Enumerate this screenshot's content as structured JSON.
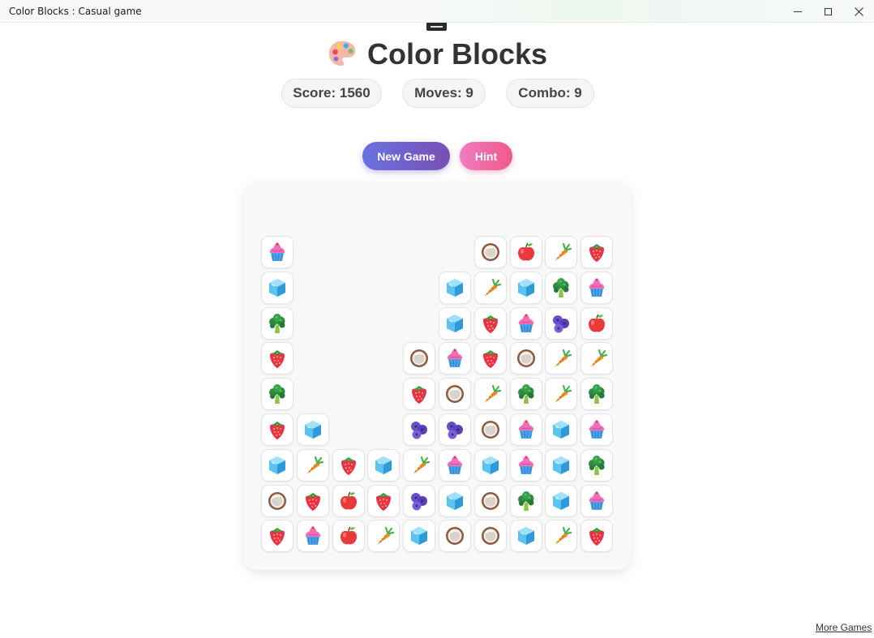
{
  "window": {
    "title": "Color Blocks : Casual game"
  },
  "header": {
    "title": "Color Blocks",
    "icon": "palette-icon"
  },
  "stats": {
    "score": "Score: 1560",
    "moves": "Moves: 9",
    "combo": "Combo: 9"
  },
  "buttons": {
    "new_game": "New Game",
    "hint": "Hint"
  },
  "footer": {
    "more_games": "More Games"
  },
  "colors": {
    "new_game_start": "#6872e0",
    "new_game_end": "#7a4fb4",
    "hint_start": "#f07bc0",
    "hint_end": "#ef5a8a"
  },
  "board": {
    "columns": 10,
    "rows": 9,
    "cells": [
      [
        "cupcake",
        null,
        null,
        null,
        null,
        null,
        "coconut",
        "apple",
        "carrot",
        "strawberry"
      ],
      [
        "ice-cube",
        null,
        null,
        null,
        null,
        "ice-cube",
        "carrot",
        "ice-cube",
        "broccoli",
        "cupcake"
      ],
      [
        "broccoli",
        null,
        null,
        null,
        null,
        "ice-cube",
        "strawberry",
        "cupcake",
        "blueberry",
        "apple"
      ],
      [
        "strawberry",
        null,
        null,
        null,
        "coconut",
        "cupcake",
        "strawberry",
        "coconut",
        "carrot",
        "carrot"
      ],
      [
        "broccoli",
        null,
        null,
        null,
        "strawberry",
        "coconut",
        "carrot",
        "broccoli",
        "carrot",
        "broccoli"
      ],
      [
        "strawberry",
        "ice-cube",
        null,
        null,
        "blueberry",
        "blueberry",
        "coconut",
        "cupcake",
        "ice-cube",
        "cupcake"
      ],
      [
        "ice-cube",
        "carrot",
        "strawberry",
        "ice-cube",
        "carrot",
        "cupcake",
        "ice-cube",
        "cupcake",
        "ice-cube",
        "broccoli"
      ],
      [
        "coconut",
        "strawberry",
        "apple",
        "strawberry",
        "blueberry",
        "ice-cube",
        "coconut",
        "broccoli",
        "ice-cube",
        "cupcake"
      ],
      [
        "strawberry",
        "cupcake",
        "apple",
        "carrot",
        "ice-cube",
        "coconut",
        "coconut",
        "ice-cube",
        "carrot",
        "strawberry"
      ]
    ]
  }
}
